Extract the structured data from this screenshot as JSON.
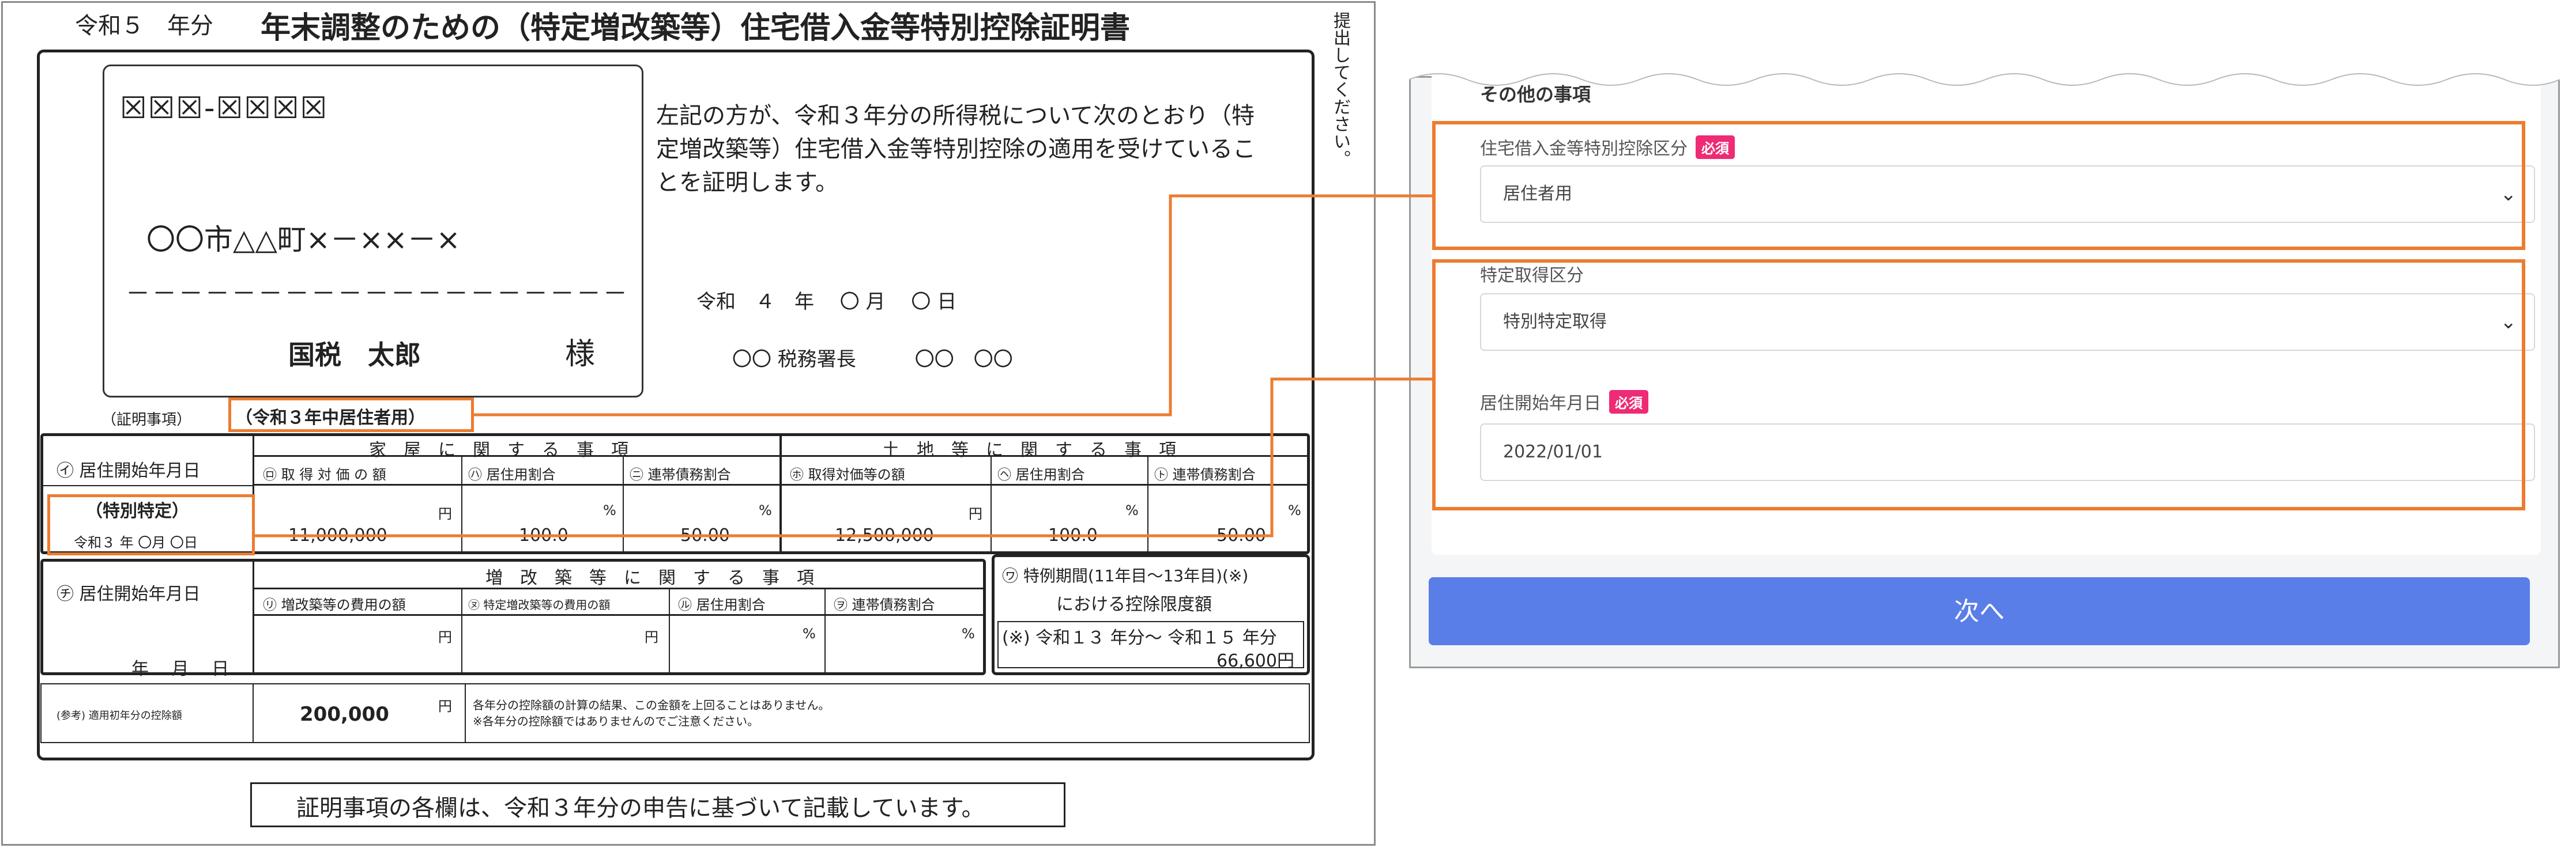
{
  "document": {
    "year_label": "令和５　年分",
    "title": "年末調整のための（特定増改築等）住宅借入金等特別控除証明書",
    "side_note": "提出してください。",
    "postal_code": "☒☒☒-☒☒☒☒",
    "address": "〇〇市△△町×－××－×",
    "address_dashes": "－－－－－－－－－－－－－－－－－－－",
    "recipient_name": "国税　太郎",
    "recipient_honorific": "様",
    "body_text": "左記の方が、令和３年分の所得税について次のとおり（特定増改築等）住宅借入金等特別控除の適用を受けていることを証明します。",
    "date_line": "令和　４　年　 〇 月　 〇 日",
    "office_line": "〇〇 税務署長　　　〇〇　〇〇",
    "cert_label": "（証明事項）",
    "cert_type": "（令和３年中居住者用）",
    "table1": {
      "row_label": "㋑ 居住開始年月日",
      "special": "（特別特定）",
      "move_in_date": "令和３ 年 〇月 〇日",
      "house_header": "家　屋　に　関　す　る　事　項",
      "land_header": "土　地　等　に　関　す　る　事　項",
      "cols": [
        "㋺ 取 得 対 価 の 額",
        "㋩ 居住用割合",
        "㋥ 連帯債務割合",
        "㋭ 取得対価等の額",
        "㋬ 居住用割合",
        "㋣ 連帯債務割合"
      ],
      "units": [
        "円",
        "%",
        "%",
        "円",
        "%",
        "%"
      ],
      "values": [
        "11,000,000",
        "100.0",
        "50.00",
        "12,500,000",
        "100.0",
        "50.00"
      ]
    },
    "table2": {
      "row_label": "㋠ 居住開始年月日",
      "date_blank": "年　 月　 日",
      "header": "増　改　築　等　に　関　す　る　事　項",
      "cols": [
        "㋷ 増改築等の費用の額",
        "㋦ 特定増改築等の費用の額",
        "㋸ 居住用割合",
        "㋾ 連帯債務割合"
      ],
      "units": [
        "円",
        "円",
        "%",
        "%"
      ]
    },
    "table3": {
      "line1": "㋻ 特例期間(11年目～13年目)(※)",
      "line2": "における控除限度額",
      "line3": "(※) 令和１３ 年分～ 令和１５ 年分",
      "value": "66,600円"
    },
    "ref_row": {
      "label": "(参考) 適用初年分の控除額",
      "value": "200,000",
      "unit": "円",
      "note1": "各年分の控除額の計算の結果、この金額を上回ることはありません。",
      "note2": "※各年分の控除額ではありませんのでご注意ください。"
    },
    "footer": "証明事項の各欄は、令和３年分の申告に基づいて記載しています。"
  },
  "form": {
    "section_title": "その他の事項",
    "loan_label": "住宅借入金等特別控除区分",
    "required_badge": "必須",
    "loan_value": "居住者用",
    "acq_label": "特定取得区分",
    "acq_value": "特別特定取得",
    "movein_label": "居住開始年月日",
    "movein_value": "2022/01/01",
    "next_button": "次へ"
  },
  "colors": {
    "highlight": "#ec7c30",
    "button": "#5a7ee8",
    "required": "#ee2b74"
  }
}
